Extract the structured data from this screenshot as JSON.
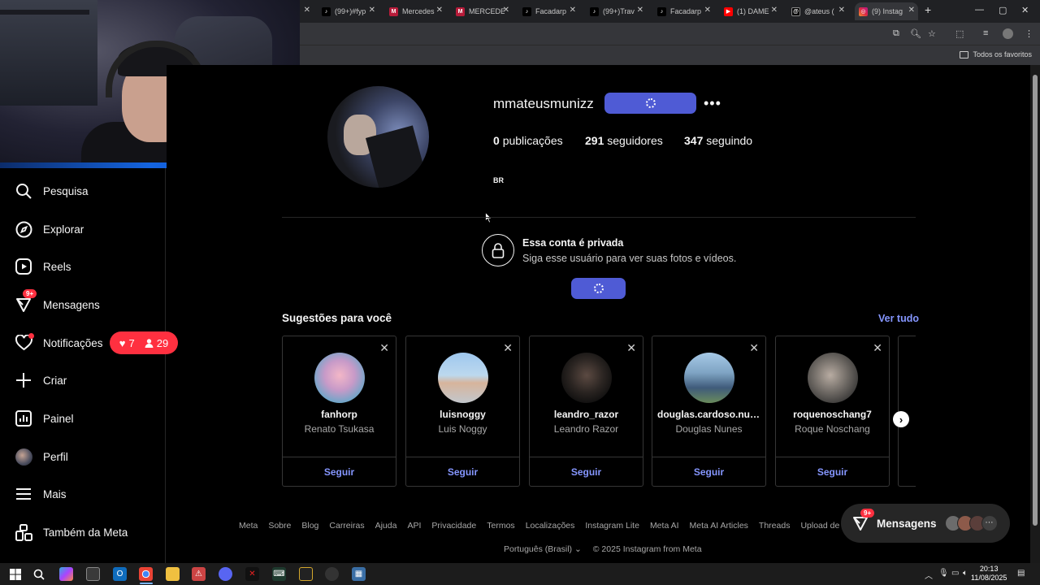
{
  "browser": {
    "tabs": [
      {
        "title": "(99+)#fyp",
        "favicon": "tiktok-icon",
        "color": "#000000"
      },
      {
        "title": "Mercedes",
        "favicon": "m-icon",
        "color": "#b71c3a"
      },
      {
        "title": "MERCEDE",
        "favicon": "m-icon",
        "color": "#b71c3a"
      },
      {
        "title": "Facadarp",
        "favicon": "tiktok-icon",
        "color": "#000000"
      },
      {
        "title": "(99+)Trav",
        "favicon": "tiktok-icon",
        "color": "#000000"
      },
      {
        "title": "Facadarp",
        "favicon": "tiktok-icon",
        "color": "#000000"
      },
      {
        "title": "(1) DAME",
        "favicon": "youtube-icon",
        "color": "#ff0000"
      },
      {
        "title": "@ateus (",
        "favicon": "threads-icon",
        "color": "#000000"
      },
      {
        "title": "(9) Instag",
        "favicon": "instagram-icon",
        "color": "#d6249f"
      }
    ],
    "favorites_label": "Todos os favoritos"
  },
  "sidebar": {
    "items": [
      {
        "label": "Pesquisa",
        "icon": "search-icon"
      },
      {
        "label": "Explorar",
        "icon": "compass-icon"
      },
      {
        "label": "Reels",
        "icon": "reels-icon"
      },
      {
        "label": "Mensagens",
        "icon": "messenger-icon",
        "badge": "9+"
      },
      {
        "label": "Notificações",
        "icon": "heart-icon"
      },
      {
        "label": "Criar",
        "icon": "plus-icon"
      },
      {
        "label": "Painel",
        "icon": "dashboard-icon"
      },
      {
        "label": "Perfil",
        "icon": "profile-avatar"
      },
      {
        "label": "Mais",
        "icon": "menu-icon"
      },
      {
        "label": "Também da Meta",
        "icon": "meta-apps-icon"
      }
    ],
    "notifications_popup": {
      "likes": "7",
      "followers": "29"
    }
  },
  "profile": {
    "username": "mmateusmunizz",
    "posts_count": "0",
    "posts_label": "publicações",
    "followers_count": "291",
    "followers_label": "seguidores",
    "following_count": "347",
    "following_label": "seguindo",
    "bio": "BR",
    "private_title": "Essa conta é privada",
    "private_subtitle": "Siga esse usuário para ver suas fotos e vídeos."
  },
  "suggestions": {
    "title": "Sugestões para você",
    "see_all": "Ver tudo",
    "follow_label": "Seguir",
    "cards": [
      {
        "username": "fanhorp",
        "name": "Renato Tsukasa"
      },
      {
        "username": "luisnoggy",
        "name": "Luis Noggy"
      },
      {
        "username": "leandro_razor",
        "name": "Leandro Razor"
      },
      {
        "username": "douglas.cardoso.nun...",
        "name": "Douglas Nunes"
      },
      {
        "username": "roquenoschang7",
        "name": "Roque Noschang"
      }
    ]
  },
  "footer": {
    "links": [
      "Meta",
      "Sobre",
      "Blog",
      "Carreiras",
      "Ajuda",
      "API",
      "Privacidade",
      "Termos",
      "Localizações",
      "Instagram Lite",
      "Meta AI",
      "Meta AI Articles",
      "Threads",
      "Upload de contato"
    ],
    "language": "Português (Brasil)",
    "copyright": "© 2025 Instagram from Meta"
  },
  "messages_pill": {
    "label": "Mensagens",
    "badge": "9+"
  },
  "taskbar": {
    "time": "20:13",
    "date": "11/08/2025"
  },
  "colors": {
    "accent_blue": "#4f5bd5",
    "link_blue": "#8596ff",
    "notification_red": "#ff3040"
  }
}
